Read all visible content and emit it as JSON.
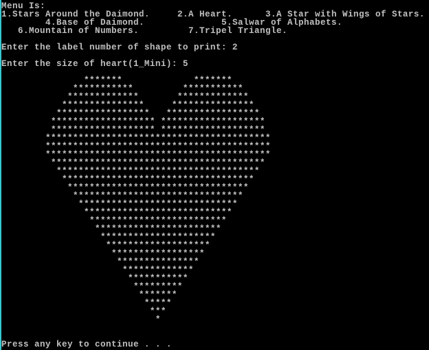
{
  "window": {
    "type": "console",
    "text_color": "#c0c0c0",
    "background_color": "#000000",
    "edge_color": "#35c8d0"
  },
  "menu": {
    "heading": "Menu Is:",
    "items": [
      {
        "number": 1,
        "label": "1.Stars Around the Daimond."
      },
      {
        "number": 2,
        "label": "2.A Heart."
      },
      {
        "number": 3,
        "label": "3.A Star with Wings of Stars."
      },
      {
        "number": 4,
        "label": "4.Base of Daimond."
      },
      {
        "number": 5,
        "label": "5.Salwar of Alphabets."
      },
      {
        "number": 6,
        "label": "6.Mountain of Numbers."
      },
      {
        "number": 7,
        "label": "7.Tripel Triangle."
      }
    ]
  },
  "prompts": {
    "shape_prompt": "Enter the label number of shape to print: 2",
    "shape_input": "2",
    "size_prompt": "Enter the size of heart(1_Mini): 5",
    "size_input": "5"
  },
  "heart": {
    "symbol": "*",
    "size": 5,
    "rows": [
      "               *******             *******",
      "             ***********         ***********",
      "            *************       *************",
      "           ***************     ***************",
      "          *****************   *****************",
      "         ******************* *******************",
      "         ******************* *******************",
      "        *****************************************",
      "        *****************************************",
      "        *****************************************",
      "         ***************************************",
      "          *************************************",
      "           ***********************************",
      "            *********************************",
      "             *******************************",
      "              *****************************",
      "               ***************************",
      "                *************************",
      "                 ***********************",
      "                  *********************",
      "                   *******************",
      "                    *****************",
      "                     ***************",
      "                      *************",
      "                       ***********",
      "                        *********",
      "                         *******",
      "                          *****",
      "                           ***",
      "                            *"
    ]
  },
  "footer": {
    "continue_prompt": "Press any key to continue . . ."
  }
}
